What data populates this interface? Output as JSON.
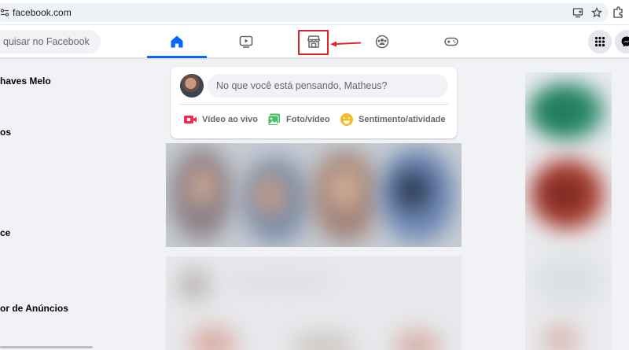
{
  "browser": {
    "url": "facebook.com",
    "icons": [
      "site-info-icon",
      "install-app-icon",
      "star-icon",
      "extensions-icon"
    ]
  },
  "topnav": {
    "search_placeholder": "quisar no Facebook",
    "tabs": [
      {
        "name": "home",
        "icon": "home-icon",
        "active": true
      },
      {
        "name": "video",
        "icon": "video-icon",
        "active": false
      },
      {
        "name": "marketplace",
        "icon": "marketplace-icon",
        "active": false,
        "highlighted": true
      },
      {
        "name": "groups",
        "icon": "groups-icon",
        "active": false
      },
      {
        "name": "gaming",
        "icon": "gaming-icon",
        "active": false
      }
    ],
    "right_buttons": [
      "menu-grid-icon",
      "messenger-icon"
    ],
    "annotation_color": "#e02424",
    "accent": "#0866ff"
  },
  "sidebar": {
    "items": [
      {
        "label": "haves Melo"
      },
      {
        "label": "os"
      },
      {
        "label": "ce"
      },
      {
        "label": "or de Anúncios"
      }
    ]
  },
  "composer": {
    "placeholder": "No que você está pensando, Matheus?",
    "actions": [
      {
        "label": "Vídeo ao vivo",
        "icon": "live-video-icon",
        "color": "#f02849"
      },
      {
        "label": "Foto/vídeo",
        "icon": "photo-icon",
        "color": "#45bd62"
      },
      {
        "label": "Sentimento/atividade",
        "icon": "feeling-icon",
        "color": "#f7b928"
      }
    ]
  }
}
